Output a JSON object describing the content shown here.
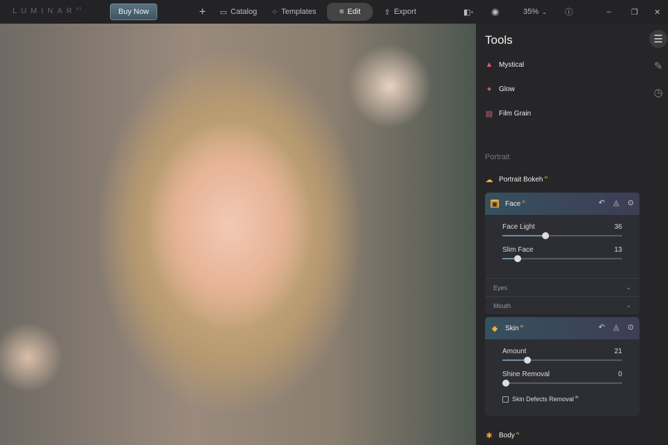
{
  "topbar": {
    "logo": "LUMINAR",
    "logo_sup": "AI",
    "buy_now": "Buy Now",
    "add": "+",
    "catalog": "Catalog",
    "templates": "Templates",
    "edit": "Edit",
    "export": "Export",
    "zoom": "35%"
  },
  "panel": {
    "title": "Tools",
    "tools": [
      {
        "label": "Mystical",
        "icon": "mystical-icon",
        "color": "#e05a7a"
      },
      {
        "label": "Glow",
        "icon": "sparkle-icon",
        "color": "#e05a7a"
      },
      {
        "label": "Film Grain",
        "icon": "film-icon",
        "color": "#e05a7a"
      }
    ],
    "section": "Portrait",
    "portrait_bokeh": "Portrait Bokeh",
    "ai": "AI",
    "face": {
      "title": "Face",
      "sliders": [
        {
          "label": "Face Light",
          "value": 36
        },
        {
          "label": "Slim Face",
          "value": 13
        }
      ],
      "subsections": [
        "Eyes",
        "Mouth"
      ]
    },
    "skin": {
      "title": "Skin",
      "sliders": [
        {
          "label": "Amount",
          "value": 21
        },
        {
          "label": "Shine Removal",
          "value": 0
        }
      ],
      "checkbox": "Skin Defects Removal",
      "checked": false
    },
    "body": "Body"
  },
  "colors": {
    "accent": "#f0a040",
    "slider_fill": "#6e8fa6"
  }
}
